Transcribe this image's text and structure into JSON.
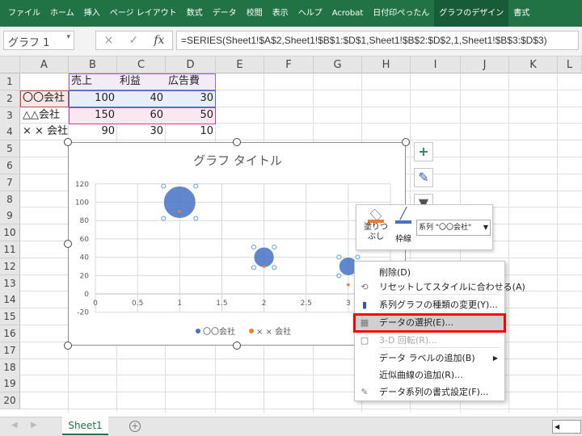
{
  "ribbon": {
    "tabs": [
      "ファイル",
      "ホーム",
      "挿入",
      "ページ レイアウト",
      "数式",
      "データ",
      "校閲",
      "表示",
      "ヘルプ",
      "Acrobat",
      "日付印ぺったん",
      "グラフのデザイン",
      "書式"
    ],
    "active": "グラフのデザイン",
    "color": "#217346"
  },
  "formula_bar": {
    "name_box": "グラフ 1",
    "cancel": "×",
    "enter": "✓",
    "fx": "fx",
    "formula": "=SERIES(Sheet1!$A$2,Sheet1!$B$1:$D$1,Sheet1!$B$2:$D$2,1,Sheet1!$B$3:$D$3)"
  },
  "columns": [
    "A",
    "B",
    "C",
    "D",
    "E",
    "F",
    "G",
    "H",
    "I",
    "J",
    "K",
    "L"
  ],
  "rows": [
    "1",
    "2",
    "3",
    "4",
    "5",
    "6",
    "7",
    "8",
    "9",
    "10",
    "11",
    "12",
    "13",
    "14",
    "15",
    "16",
    "17",
    "18",
    "19",
    "20"
  ],
  "cells": {
    "B1": "売上",
    "C1": "利益",
    "D1": "広告費",
    "A2": "〇〇会社",
    "B2": "100",
    "C2": "40",
    "D2": "30",
    "A3": "△△会社",
    "B3": "150",
    "C3": "60",
    "D3": "50",
    "A4": "× × 会社",
    "B4": "90",
    "C4": "30",
    "D4": "10"
  },
  "chart_data": {
    "type": "bubble",
    "title": "グラフ タイトル",
    "xlim": [
      0,
      3.5
    ],
    "ylim": [
      -20,
      120
    ],
    "x_ticks": [
      "0",
      "0.5",
      "1",
      "1.5",
      "2",
      "2.5",
      "3"
    ],
    "y_ticks": [
      "120",
      "100",
      "80",
      "60",
      "40",
      "20",
      "0",
      "-20"
    ],
    "series": [
      {
        "name": "〇〇会社",
        "x": [
          1,
          2,
          3
        ],
        "y": [
          100,
          40,
          30
        ],
        "size": [
          150,
          60,
          50
        ],
        "color": "#4472c4"
      },
      {
        "name": "× × 会社",
        "x": [
          1,
          2,
          3
        ],
        "y": [
          90,
          30,
          10
        ],
        "color": "#ed7d31"
      }
    ],
    "legend": "bottom",
    "grid": true
  },
  "side_buttons": {
    "add": "+",
    "style": "brush",
    "filter": "filter"
  },
  "mini_toolbar": {
    "fill_label_1": "塗りつ",
    "fill_label_2": "ぶし",
    "outline_label": "枠線",
    "series_select": "系列 \"〇〇会社\""
  },
  "context_menu": [
    {
      "label": "削除(D)"
    },
    {
      "label": "リセットしてスタイルに合わせる(A)"
    },
    {
      "label": "系列グラフの種類の変更(Y)..."
    },
    {
      "label": "データの選択(E)...",
      "highlighted": true
    },
    {
      "label": "3-D 回転(R)...",
      "disabled": true
    },
    {
      "label": "データ ラベルの追加(B)"
    },
    {
      "label": "近似曲線の追加(R)..."
    },
    {
      "label": "データ系列の書式設定(F)..."
    }
  ],
  "sheet_tabs": {
    "active": "Sheet1",
    "add": "+"
  }
}
